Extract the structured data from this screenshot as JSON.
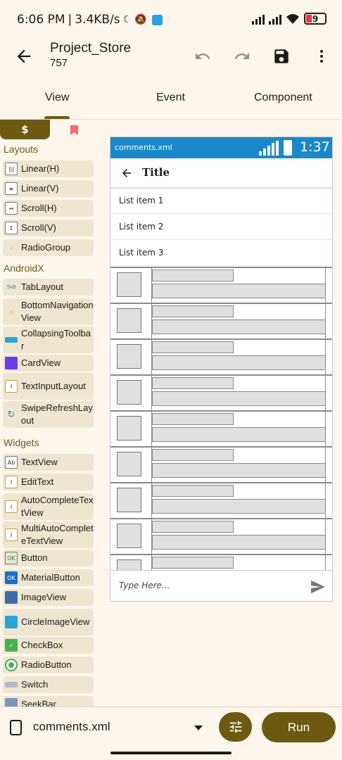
{
  "status": {
    "time": "6:06 PM",
    "speed": "3.4KB/s",
    "battery": "9"
  },
  "header": {
    "title": "Project_Store",
    "subtitle": "757"
  },
  "tabs": [
    {
      "label": "View"
    },
    {
      "label": "Event"
    },
    {
      "label": "Component"
    }
  ],
  "palette": {
    "tab_icon": "$",
    "sections": {
      "layouts": "Layouts",
      "androidx": "AndroidX",
      "widgets": "Widgets"
    },
    "items": [
      {
        "label": "Linear(H)",
        "icon": "linear-h-icon"
      },
      {
        "label": "Linear(V)",
        "icon": "linear-v-icon"
      },
      {
        "label": "Scroll(H)",
        "icon": "scroll-h-icon"
      },
      {
        "label": "Scroll(V)",
        "icon": "scroll-v-icon"
      },
      {
        "label": "RadioGroup",
        "icon": "radiogroup-icon"
      },
      {
        "label": "TabLayout",
        "icon": "tablayout-icon"
      },
      {
        "label": "BottomNavigationView",
        "icon": "bottomnav-icon"
      },
      {
        "label": "CollapsingToolbar",
        "icon": "toolbar-icon"
      },
      {
        "label": "CardView",
        "icon": "cardview-icon"
      },
      {
        "label": "TextInputLayout",
        "icon": "textinput-icon"
      },
      {
        "label": "SwipeRefreshLayout",
        "icon": "refresh-icon"
      },
      {
        "label": "TextView",
        "icon": "textview-icon"
      },
      {
        "label": "EditText",
        "icon": "edittext-icon"
      },
      {
        "label": "AutoCompleteTextView",
        "icon": "autocomplete-icon"
      },
      {
        "label": "MultiAutoCompleteTextView",
        "icon": "multiautocomplete-icon"
      },
      {
        "label": "Button",
        "icon": "button-icon"
      },
      {
        "label": "MaterialButton",
        "icon": "materialbutton-icon"
      },
      {
        "label": "ImageView",
        "icon": "imageview-icon"
      },
      {
        "label": "CircleImageView",
        "icon": "circleimage-icon"
      },
      {
        "label": "CheckBox",
        "icon": "checkbox-icon"
      },
      {
        "label": "RadioButton",
        "icon": "radiobutton-icon"
      },
      {
        "label": "Switch",
        "icon": "switch-icon"
      },
      {
        "label": "SeekBar",
        "icon": "seekbar-icon"
      }
    ]
  },
  "preview": {
    "file": "comments.xml",
    "time": "1:37",
    "title": "Title",
    "list_items": [
      "List item 1",
      "List item 2",
      "List item 3"
    ],
    "input_placeholder": "Type Here..."
  },
  "bottom": {
    "file": "comments.xml",
    "run_label": "Run"
  },
  "colors": {
    "accent": "#6b5a10",
    "background": "#fdf6ec",
    "preview_status": "#1a88c9"
  }
}
